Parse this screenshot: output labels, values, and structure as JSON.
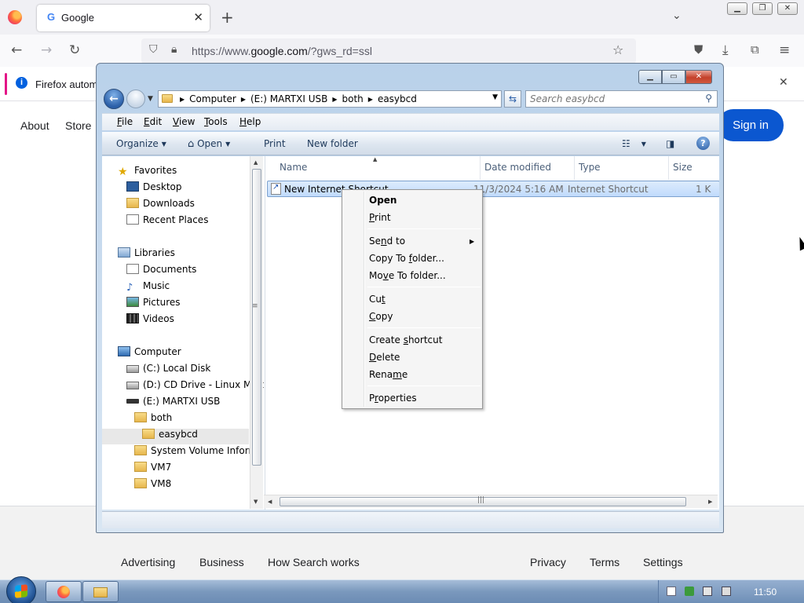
{
  "firefox": {
    "tab": {
      "title": "Google",
      "favicon": "google-g-icon"
    },
    "url": {
      "prefix": "https://www.",
      "domain": "google.com",
      "suffix": "/?gws_rd=ssl"
    },
    "notification": "Firefox automa",
    "win_buttons": [
      "minimize-icon",
      "restore-icon",
      "close-icon"
    ]
  },
  "google": {
    "header_links": [
      "About",
      "Store"
    ],
    "signin": "Sign in",
    "footer_left": [
      "Advertising",
      "Business",
      "How Search works"
    ],
    "footer_right": [
      "Privacy",
      "Terms",
      "Settings"
    ]
  },
  "explorer": {
    "breadcrumb": [
      "Computer",
      "(E:) MARTXI USB",
      "both",
      "easybcd"
    ],
    "search_placeholder": "Search easybcd",
    "menu": [
      {
        "pre": "",
        "u": "F",
        "post": "ile"
      },
      {
        "pre": "",
        "u": "E",
        "post": "dit"
      },
      {
        "pre": "",
        "u": "V",
        "post": "iew"
      },
      {
        "pre": "",
        "u": "T",
        "post": "ools"
      },
      {
        "pre": "",
        "u": "H",
        "post": "elp"
      }
    ],
    "commands": {
      "organize": "Organize",
      "open": "Open",
      "print": "Print",
      "new_folder": "New folder"
    },
    "nav": {
      "favorites": "Favorites",
      "desktop": "Desktop",
      "downloads": "Downloads",
      "recent": "Recent Places",
      "libraries": "Libraries",
      "documents": "Documents",
      "music": "Music",
      "pictures": "Pictures",
      "videos": "Videos",
      "computer": "Computer",
      "c_drive": "(C:) Local Disk",
      "d_drive": "(D:) CD Drive - Linux Mint",
      "e_drive": "(E:) MARTXI USB",
      "both": "both",
      "easybcd": "easybcd",
      "sysvol": "System Volume Informa",
      "vm7": "VM7",
      "vm8": "VM8"
    },
    "columns": {
      "name": "Name",
      "date": "Date modified",
      "type": "Type",
      "size": "Size"
    },
    "file": {
      "name": "New Internet Shortcut",
      "date": "11/3/2024 5:16 AM",
      "type": "Internet Shortcut",
      "size": "1 K"
    }
  },
  "context_menu": {
    "open": "Open",
    "print": {
      "u": "P",
      "post": "rint"
    },
    "send_to": {
      "pre": "Se",
      "u": "n",
      "post": "d to"
    },
    "copy_to": {
      "pre": "Copy To ",
      "u": "f",
      "post": "older..."
    },
    "move_to": {
      "pre": "Mo",
      "u": "v",
      "post": "e To folder..."
    },
    "cut": {
      "pre": "Cu",
      "u": "t",
      "post": ""
    },
    "copy": {
      "pre": "",
      "u": "C",
      "post": "opy"
    },
    "create_shortcut": {
      "pre": "Create ",
      "u": "s",
      "post": "hortcut"
    },
    "delete": {
      "pre": "",
      "u": "D",
      "post": "elete"
    },
    "rename": {
      "pre": "Rena",
      "u": "m",
      "post": "e"
    },
    "properties": {
      "pre": "P",
      "u": "r",
      "post": "operties"
    }
  },
  "taskbar": {
    "clock": "11:50"
  },
  "colors": {
    "accent": "#0b57d0",
    "selection": "#c1dbfc",
    "taskbar": "#7a98bd"
  }
}
